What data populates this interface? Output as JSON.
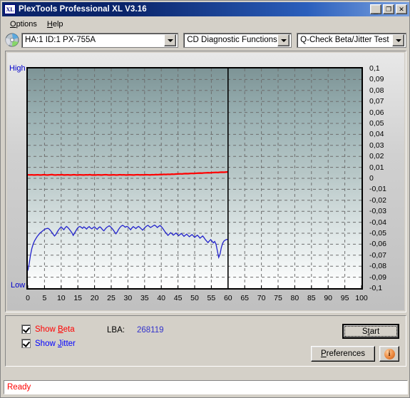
{
  "window": {
    "title": "PlexTools Professional XL V3.16",
    "icon": "XL",
    "buttons": {
      "minimize": "_",
      "maximize": "❐",
      "close": "✕"
    }
  },
  "menu": {
    "items": [
      {
        "label": "Options",
        "accel": "O"
      },
      {
        "label": "Help",
        "accel": "H"
      }
    ]
  },
  "toolbar": {
    "drive_icon": "disc-icon",
    "drive": "HA:1 ID:1  PX-755A",
    "function": "CD Diagnostic Functions",
    "test": "Q-Check Beta/Jitter Test"
  },
  "controls": {
    "show_beta": "Show Beta",
    "show_beta_accel": "B",
    "show_jitter": "Show Jitter",
    "show_jitter_accel": "J",
    "beta_color": "#ff0000",
    "jitter_color": "#0000ff",
    "lba_label": "LBA:",
    "lba_value": "268119",
    "start_label": "Start",
    "start_accel": "t",
    "preferences_label": "Preferences",
    "preferences_accel": "P",
    "info_label": "i"
  },
  "statusbar": {
    "text": "Ready",
    "color": "#ff0000"
  },
  "chart_data": {
    "type": "line",
    "title": "Q-Check Beta/Jitter Test",
    "xlabel": "",
    "ylabel": "",
    "xlim": [
      0,
      100
    ],
    "ylim": [
      -0.1,
      0.1
    ],
    "grid": true,
    "legend_position": "bottom-external",
    "y_axis_top_label": "High",
    "y_axis_bottom_label": "Low",
    "y_axis_label_color": "#0000cc",
    "xticks": [
      0,
      5,
      10,
      15,
      20,
      25,
      30,
      35,
      40,
      45,
      50,
      55,
      60,
      65,
      70,
      75,
      80,
      85,
      90,
      95,
      100
    ],
    "xtick_labels": [
      "0",
      "5",
      "10",
      "15",
      "20",
      "25",
      "30",
      "35",
      "40",
      "45",
      "50",
      "55",
      "60",
      "65",
      "70",
      "75",
      "80",
      "85",
      "90",
      "95",
      "100"
    ],
    "yticks": [
      0.1,
      0.09,
      0.08,
      0.07,
      0.06,
      0.05,
      0.04,
      0.03,
      0.02,
      0.01,
      0,
      -0.01,
      -0.02,
      -0.03,
      -0.04,
      -0.05,
      -0.06,
      -0.07,
      -0.08,
      -0.09,
      -0.1
    ],
    "ytick_labels": [
      "0,1",
      "0,09",
      "0,08",
      "0,07",
      "0,06",
      "0,05",
      "0,04",
      "0,03",
      "0,02",
      "0,01",
      "0",
      "-0,01",
      "-0,02",
      "-0,03",
      "-0,04",
      "-0,05",
      "-0,06",
      "-0,07",
      "-0,08",
      "-0,09",
      "-0,1"
    ],
    "scan_end_marker_x": 60,
    "scan_end_marker_color": "#000000",
    "series": [
      {
        "name": "Beta",
        "color": "#ff0000",
        "x": [
          0.0,
          0.6,
          1.2,
          1.8,
          2.4,
          3.0,
          3.6,
          4.2,
          4.8,
          5.4,
          6.0,
          6.6,
          7.2,
          7.8,
          8.4,
          9.0,
          9.6,
          10.2,
          10.8,
          11.4,
          12.0,
          12.6,
          13.2,
          13.8,
          14.4,
          15.0,
          15.6,
          16.2,
          16.8,
          17.4,
          18.0,
          18.6,
          19.2,
          19.8,
          20.4,
          21.0,
          21.6,
          22.2,
          22.8,
          23.4,
          24.0,
          24.6,
          25.2,
          25.8,
          26.4,
          27.0,
          27.6,
          28.2,
          28.8,
          29.4,
          30.0,
          30.6,
          31.2,
          31.8,
          32.4,
          33.0,
          33.6,
          34.2,
          34.8,
          35.4,
          36.0,
          36.6,
          37.2,
          37.8,
          38.4,
          39.0,
          39.6,
          40.2,
          40.8,
          41.4,
          42.0,
          42.6,
          43.2,
          43.8,
          44.4,
          45.0,
          45.6,
          46.2,
          46.8,
          47.4,
          48.0,
          48.6,
          49.2,
          49.8,
          50.4,
          51.0,
          51.6,
          52.2,
          52.8,
          53.4,
          54.0,
          54.6,
          55.2,
          55.8,
          56.4,
          57.0,
          57.6,
          58.2,
          58.8,
          59.4,
          60.0
        ],
        "y": [
          0.0032,
          0.0031,
          0.0032,
          0.003,
          0.0031,
          0.0032,
          0.003,
          0.0031,
          0.0033,
          0.0031,
          0.003,
          0.0032,
          0.0034,
          0.0031,
          0.003,
          0.0032,
          0.0031,
          0.0033,
          0.003,
          0.0031,
          0.0032,
          0.003,
          0.0031,
          0.0033,
          0.0031,
          0.003,
          0.0032,
          0.0031,
          0.003,
          0.0032,
          0.0031,
          0.0033,
          0.003,
          0.0031,
          0.003,
          0.0032,
          0.0031,
          0.003,
          0.0032,
          0.0033,
          0.0031,
          0.003,
          0.0031,
          0.0032,
          0.003,
          0.0031,
          0.0033,
          0.0031,
          0.0032,
          0.003,
          0.0031,
          0.0032,
          0.0031,
          0.003,
          0.0032,
          0.0033,
          0.0031,
          0.0032,
          0.0031,
          0.0033,
          0.0032,
          0.0031,
          0.0033,
          0.0032,
          0.0034,
          0.0033,
          0.0035,
          0.0034,
          0.0036,
          0.0035,
          0.0037,
          0.0036,
          0.0038,
          0.0037,
          0.0039,
          0.004,
          0.0041,
          0.004,
          0.0042,
          0.0043,
          0.0042,
          0.0044,
          0.0045,
          0.0044,
          0.0046,
          0.0047,
          0.0048,
          0.0047,
          0.0049,
          0.005,
          0.0051,
          0.005,
          0.0052,
          0.0053,
          0.0054,
          0.0053,
          0.0055,
          0.0056,
          0.0055,
          0.0057,
          0.0058
        ]
      },
      {
        "name": "Jitter",
        "color": "#2222cc",
        "x": [
          0.0,
          0.4,
          0.8,
          1.2,
          1.6,
          2.0,
          2.4,
          2.8,
          3.2,
          3.6,
          4.0,
          4.4,
          4.8,
          5.2,
          5.6,
          6.0,
          6.4,
          6.8,
          7.2,
          7.6,
          8.0,
          8.4,
          8.8,
          9.2,
          9.6,
          10.0,
          10.4,
          10.8,
          11.2,
          11.6,
          12.0,
          12.4,
          12.8,
          13.2,
          13.6,
          14.0,
          14.4,
          14.8,
          15.2,
          15.6,
          16.0,
          16.4,
          16.8,
          17.2,
          17.6,
          18.0,
          18.4,
          18.8,
          19.2,
          19.6,
          20.0,
          20.4,
          20.8,
          21.2,
          21.6,
          22.0,
          22.4,
          22.8,
          23.2,
          23.6,
          24.0,
          24.4,
          24.8,
          25.2,
          25.6,
          26.0,
          26.4,
          26.8,
          27.2,
          27.6,
          28.0,
          28.4,
          28.8,
          29.2,
          29.6,
          30.0,
          30.4,
          30.8,
          31.2,
          31.6,
          32.0,
          32.4,
          32.8,
          33.2,
          33.6,
          34.0,
          34.4,
          34.8,
          35.2,
          35.6,
          36.0,
          36.4,
          36.8,
          37.2,
          37.6,
          38.0,
          38.4,
          38.8,
          39.2,
          39.6,
          40.0,
          40.4,
          40.8,
          41.2,
          41.6,
          42.0,
          42.4,
          42.8,
          43.2,
          43.6,
          44.0,
          44.4,
          44.8,
          45.2,
          45.6,
          46.0,
          46.4,
          46.8,
          47.2,
          47.6,
          48.0,
          48.4,
          48.8,
          49.2,
          49.6,
          50.0,
          50.4,
          50.8,
          51.2,
          51.6,
          52.0,
          52.4,
          52.8,
          53.2,
          53.6,
          54.0,
          54.4,
          54.8,
          55.2,
          55.6,
          56.0,
          56.4,
          56.8,
          57.2,
          57.6,
          58.0,
          58.4,
          58.8,
          59.2,
          59.6,
          60.0
        ],
        "y": [
          -0.084,
          -0.078,
          -0.07,
          -0.064,
          -0.06,
          -0.057,
          -0.055,
          -0.053,
          -0.0515,
          -0.05,
          -0.049,
          -0.048,
          -0.047,
          -0.0462,
          -0.0458,
          -0.0455,
          -0.0462,
          -0.0475,
          -0.0492,
          -0.051,
          -0.0525,
          -0.0512,
          -0.049,
          -0.047,
          -0.0455,
          -0.0442,
          -0.0455,
          -0.0468,
          -0.045,
          -0.0438,
          -0.0448,
          -0.0462,
          -0.0478,
          -0.0495,
          -0.052,
          -0.05,
          -0.0478,
          -0.0458,
          -0.0444,
          -0.0438,
          -0.0446,
          -0.0455,
          -0.0442,
          -0.045,
          -0.0462,
          -0.0448,
          -0.044,
          -0.0452,
          -0.046,
          -0.0448,
          -0.0442,
          -0.0455,
          -0.0465,
          -0.045,
          -0.0442,
          -0.0452,
          -0.0468,
          -0.0478,
          -0.0462,
          -0.0448,
          -0.044,
          -0.0432,
          -0.0442,
          -0.0455,
          -0.047,
          -0.0488,
          -0.0505,
          -0.0488,
          -0.0465,
          -0.0448,
          -0.0435,
          -0.0428,
          -0.0435,
          -0.0445,
          -0.0438,
          -0.0442,
          -0.0455,
          -0.0468,
          -0.0452,
          -0.044,
          -0.0448,
          -0.0458,
          -0.0445,
          -0.0438,
          -0.0448,
          -0.046,
          -0.0472,
          -0.0458,
          -0.0445,
          -0.0435,
          -0.0428,
          -0.0438,
          -0.0448,
          -0.044,
          -0.0432,
          -0.0426,
          -0.0435,
          -0.0448,
          -0.0438,
          -0.043,
          -0.044,
          -0.0455,
          -0.0472,
          -0.049,
          -0.0505,
          -0.052,
          -0.0508,
          -0.0495,
          -0.0505,
          -0.0518,
          -0.0508,
          -0.0498,
          -0.051,
          -0.0522,
          -0.0512,
          -0.0502,
          -0.0515,
          -0.0528,
          -0.0518,
          -0.0508,
          -0.052,
          -0.0532,
          -0.0522,
          -0.0512,
          -0.0525,
          -0.0538,
          -0.0528,
          -0.0518,
          -0.053,
          -0.0545,
          -0.0535,
          -0.0525,
          -0.054,
          -0.0558,
          -0.0572,
          -0.0585,
          -0.057,
          -0.0558,
          -0.0572,
          -0.0588,
          -0.0575,
          -0.06,
          -0.066,
          -0.072,
          -0.069,
          -0.063,
          -0.059,
          -0.057,
          -0.0562,
          -0.0556,
          -0.0558
        ]
      }
    ]
  }
}
